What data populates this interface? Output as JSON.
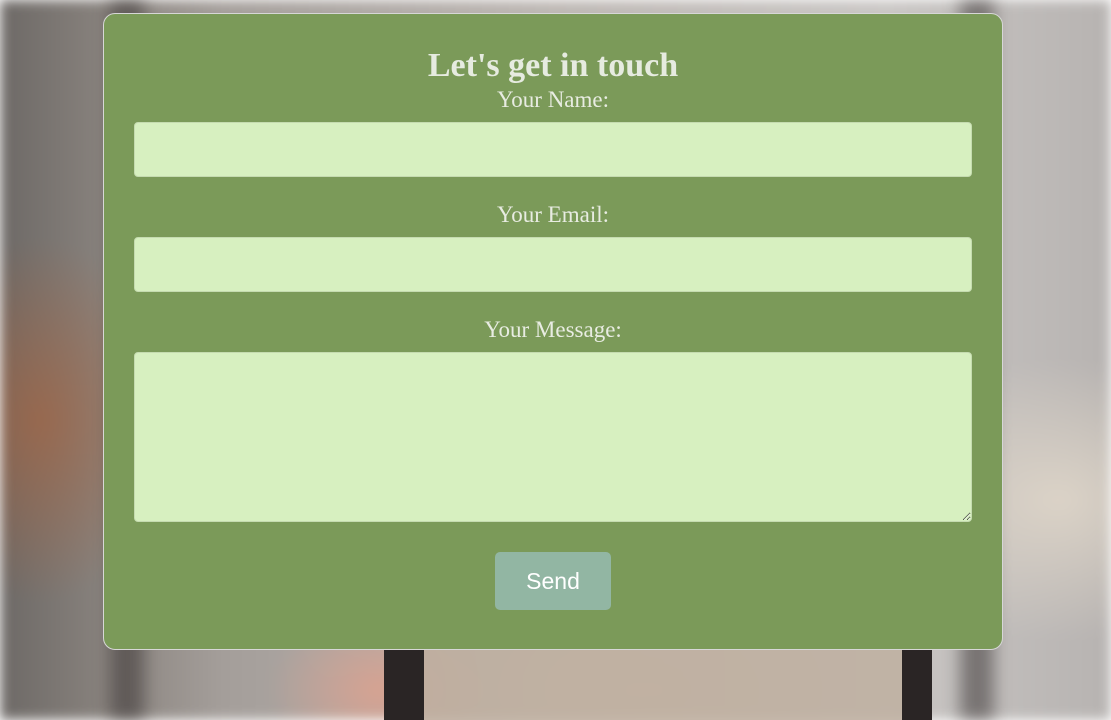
{
  "form": {
    "title": "Let's get in touch",
    "name_label": "Your Name:",
    "name_value": "",
    "email_label": "Your Email:",
    "email_value": "",
    "message_label": "Your Message:",
    "message_value": "",
    "submit_label": "Send"
  },
  "colors": {
    "card_background": "#7b9a59",
    "field_background": "#d7f0c0",
    "button_background": "#92b6a3",
    "text": "#e8ece2"
  }
}
